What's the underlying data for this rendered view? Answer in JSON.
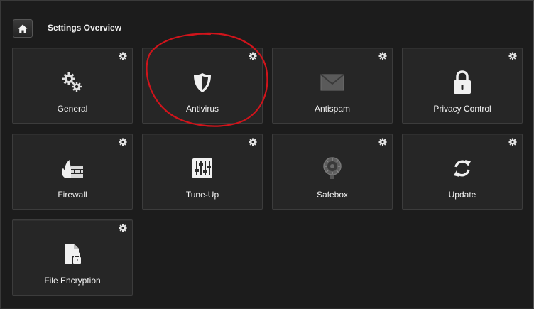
{
  "header": {
    "title": "Settings Overview",
    "home_icon": "home-icon"
  },
  "tiles": [
    {
      "label": "General",
      "icon": "gears-icon"
    },
    {
      "label": "Antivirus",
      "icon": "shield-icon"
    },
    {
      "label": "Antispam",
      "icon": "envelope-icon"
    },
    {
      "label": "Privacy Control",
      "icon": "lock-icon"
    },
    {
      "label": "Firewall",
      "icon": "firewall-icon"
    },
    {
      "label": "Tune-Up",
      "icon": "sliders-icon"
    },
    {
      "label": "Safebox",
      "icon": "safebox-icon"
    },
    {
      "label": "Update",
      "icon": "refresh-icon"
    },
    {
      "label": "File Encryption",
      "icon": "file-lock-icon"
    }
  ],
  "colors": {
    "background": "#1c1c1c",
    "tile": "#262626",
    "annotation": "#d0141b"
  }
}
